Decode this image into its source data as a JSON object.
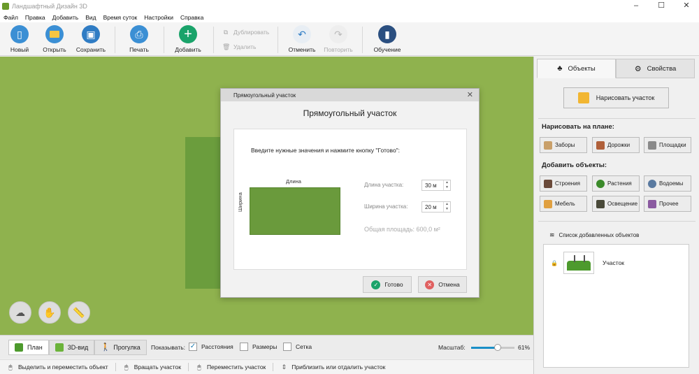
{
  "window": {
    "title": "Ландшафтный Дизайн 3D"
  },
  "menu": [
    "Файл",
    "Правка",
    "Добавить",
    "Вид",
    "Время суток",
    "Настройки",
    "Справка"
  ],
  "toolbar": {
    "new": "Новый",
    "open": "Открыть",
    "save": "Сохранить",
    "print": "Печать",
    "add": "Добавить",
    "duplicate": "Дублировать",
    "delete": "Удалить",
    "undo": "Отменить",
    "redo": "Повторить",
    "tutorial": "Обучение"
  },
  "dialog": {
    "title": "Прямоугольный участок",
    "heading": "Прямоугольный участок",
    "instruction": "Введите нужные значения и нажмите кнопку \"Готово\":",
    "length_caption": "Длина",
    "width_caption": "Ширина",
    "length_label": "Длина участка:",
    "length_value": "30 м",
    "width_label": "Ширина участка:",
    "width_value": "20 м",
    "area_label": "Общая площадь:",
    "area_value": "600,0 м²",
    "ok_label": "Готово",
    "cancel_label": "Отмена"
  },
  "view_tabs": {
    "plan": "План",
    "view3d": "3D-вид",
    "walk": "Прогулка"
  },
  "display": {
    "label": "Показывать:",
    "distances": {
      "label": "Расстояния",
      "checked": true
    },
    "dimensions": {
      "label": "Размеры",
      "checked": false
    },
    "grid": {
      "label": "Сетка",
      "checked": false
    }
  },
  "zoom": {
    "label": "Масштаб:",
    "value_text": "61%",
    "value": 0.61
  },
  "status": [
    "Выделить и переместить объект",
    "Вращать участок",
    "Переместить участок",
    "Приблизить или отдалить участок"
  ],
  "right_panel": {
    "tab_objects": "Объекты",
    "tab_properties": "Свойства",
    "draw_plot_button": "Нарисовать участок",
    "draw_on_plan_heading": "Нарисовать на плане:",
    "fences": "Заборы",
    "paths": "Дорожки",
    "areas": "Площадки",
    "add_objects_heading": "Добавить объекты:",
    "buildings": "Строения",
    "plants": "Растения",
    "ponds": "Водоемы",
    "furniture": "Мебель",
    "lighting": "Освещение",
    "other": "Прочее",
    "object_list_title": "Список добавленных объектов",
    "objects": [
      "Участок"
    ]
  },
  "colors": {
    "canvas_green": "#8fb24e",
    "plot_green": "#6b9d3d",
    "accent_blue": "#1a8fc7",
    "ok_green": "#1aa36a",
    "cancel_red": "#e06060"
  }
}
